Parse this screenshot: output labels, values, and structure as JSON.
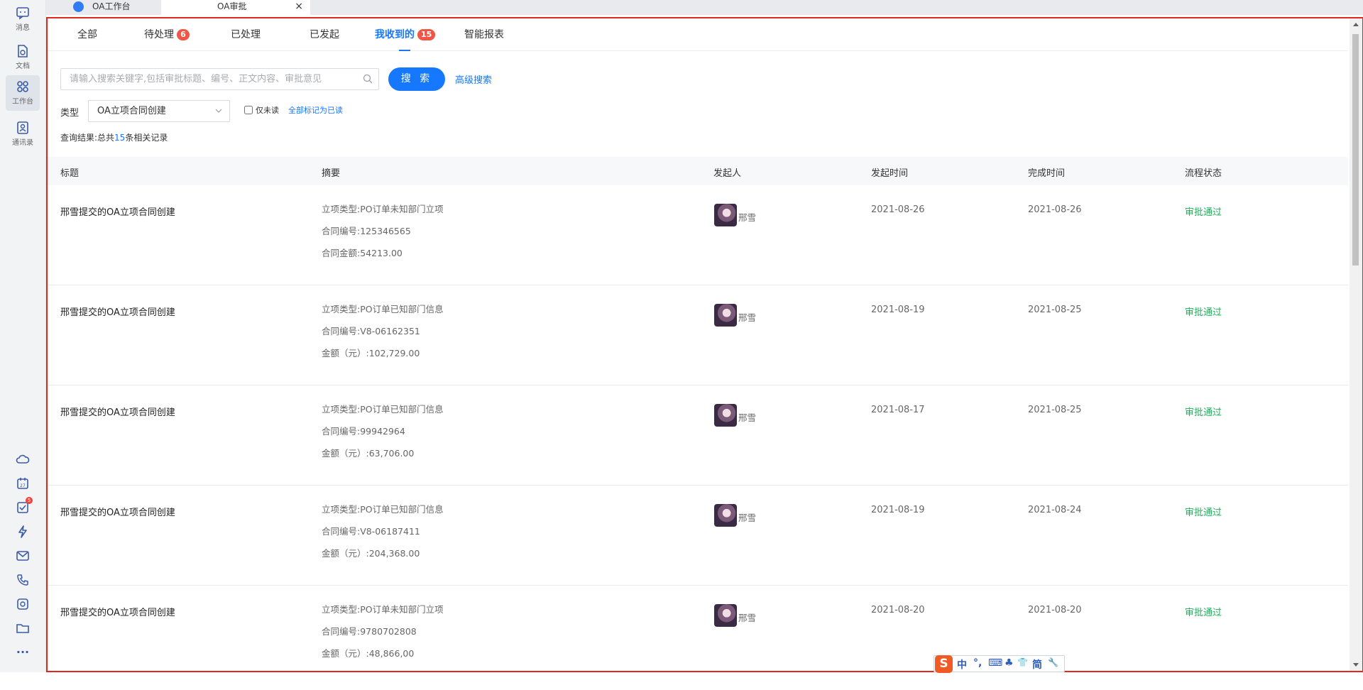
{
  "rail": {
    "items": [
      {
        "label": "消息",
        "icon": "message-icon"
      },
      {
        "label": "文档",
        "icon": "document-icon"
      },
      {
        "label": "工作台",
        "icon": "workbench-icon"
      },
      {
        "label": "通讯录",
        "icon": "contacts-icon"
      }
    ],
    "tools_badge": "5",
    "more": "···"
  },
  "window_tabs": {
    "tab1": "OA工作台",
    "tab2": "OA审批",
    "close": "×"
  },
  "subtabs": {
    "all": "全部",
    "pending": "待处理",
    "pending_count": "6",
    "processed": "已处理",
    "initiated": "已发起",
    "received": "我收到的",
    "received_count": "15",
    "reports": "智能报表"
  },
  "search": {
    "placeholder": "请输入搜索关键字,包括审批标题、编号、正文内容、审批意见",
    "button": "搜 索",
    "advanced": "高级搜索"
  },
  "filter": {
    "type_label": "类型",
    "type_value": "OA立项合同创建",
    "unread_only": "仅未读",
    "mark_all": "全部标记为已读"
  },
  "result": {
    "prefix": "查询结果:总共",
    "count": "15",
    "suffix": "条相关记录"
  },
  "table": {
    "headers": {
      "title": "标题",
      "summary": "摘要",
      "initiator": "发起人",
      "start": "发起时间",
      "end": "完成时间",
      "status": "流程状态"
    },
    "rows": [
      {
        "title": "邢雪提交的OA立项合同创建",
        "summary": [
          "立项类型:PO订单未知部门立项",
          "合同编号:125346565",
          "合同金额:54213.00"
        ],
        "initiator": "邢雪",
        "start": "2021-08-26",
        "end": "2021-08-26",
        "status": "审批通过"
      },
      {
        "title": "邢雪提交的OA立项合同创建",
        "summary": [
          "立项类型:PO订单已知部门信息",
          "合同编号:V8-06162351",
          "金额（元）:102,729.00"
        ],
        "initiator": "邢雪",
        "start": "2021-08-19",
        "end": "2021-08-25",
        "status": "审批通过"
      },
      {
        "title": "邢雪提交的OA立项合同创建",
        "summary": [
          "立项类型:PO订单已知部门信息",
          "合同编号:99942964",
          "金额（元）:63,706.00"
        ],
        "initiator": "邢雪",
        "start": "2021-08-17",
        "end": "2021-08-25",
        "status": "审批通过"
      },
      {
        "title": "邢雪提交的OA立项合同创建",
        "summary": [
          "立项类型:PO订单已知部门信息",
          "合同编号:V8-06187411",
          "金额（元）:204,368.00"
        ],
        "initiator": "邢雪",
        "start": "2021-08-19",
        "end": "2021-08-24",
        "status": "审批通过"
      },
      {
        "title": "邢雪提交的OA立项合同创建",
        "summary": [
          "立项类型:PO订单未知部门立项",
          "合同编号:9780702808",
          "金额（元）:48,866,00"
        ],
        "initiator": "邢雪",
        "start": "2021-08-20",
        "end": "2021-08-20",
        "status": "审批通过"
      }
    ]
  },
  "ime": {
    "logo": "S",
    "items": [
      "中",
      "°,",
      "⌨",
      "♣",
      "👕",
      "简",
      "🔧"
    ]
  },
  "colors": {
    "accent": "#1677ff",
    "badge": "#f05545",
    "success": "#19b35a",
    "frame": "#e0281f"
  }
}
